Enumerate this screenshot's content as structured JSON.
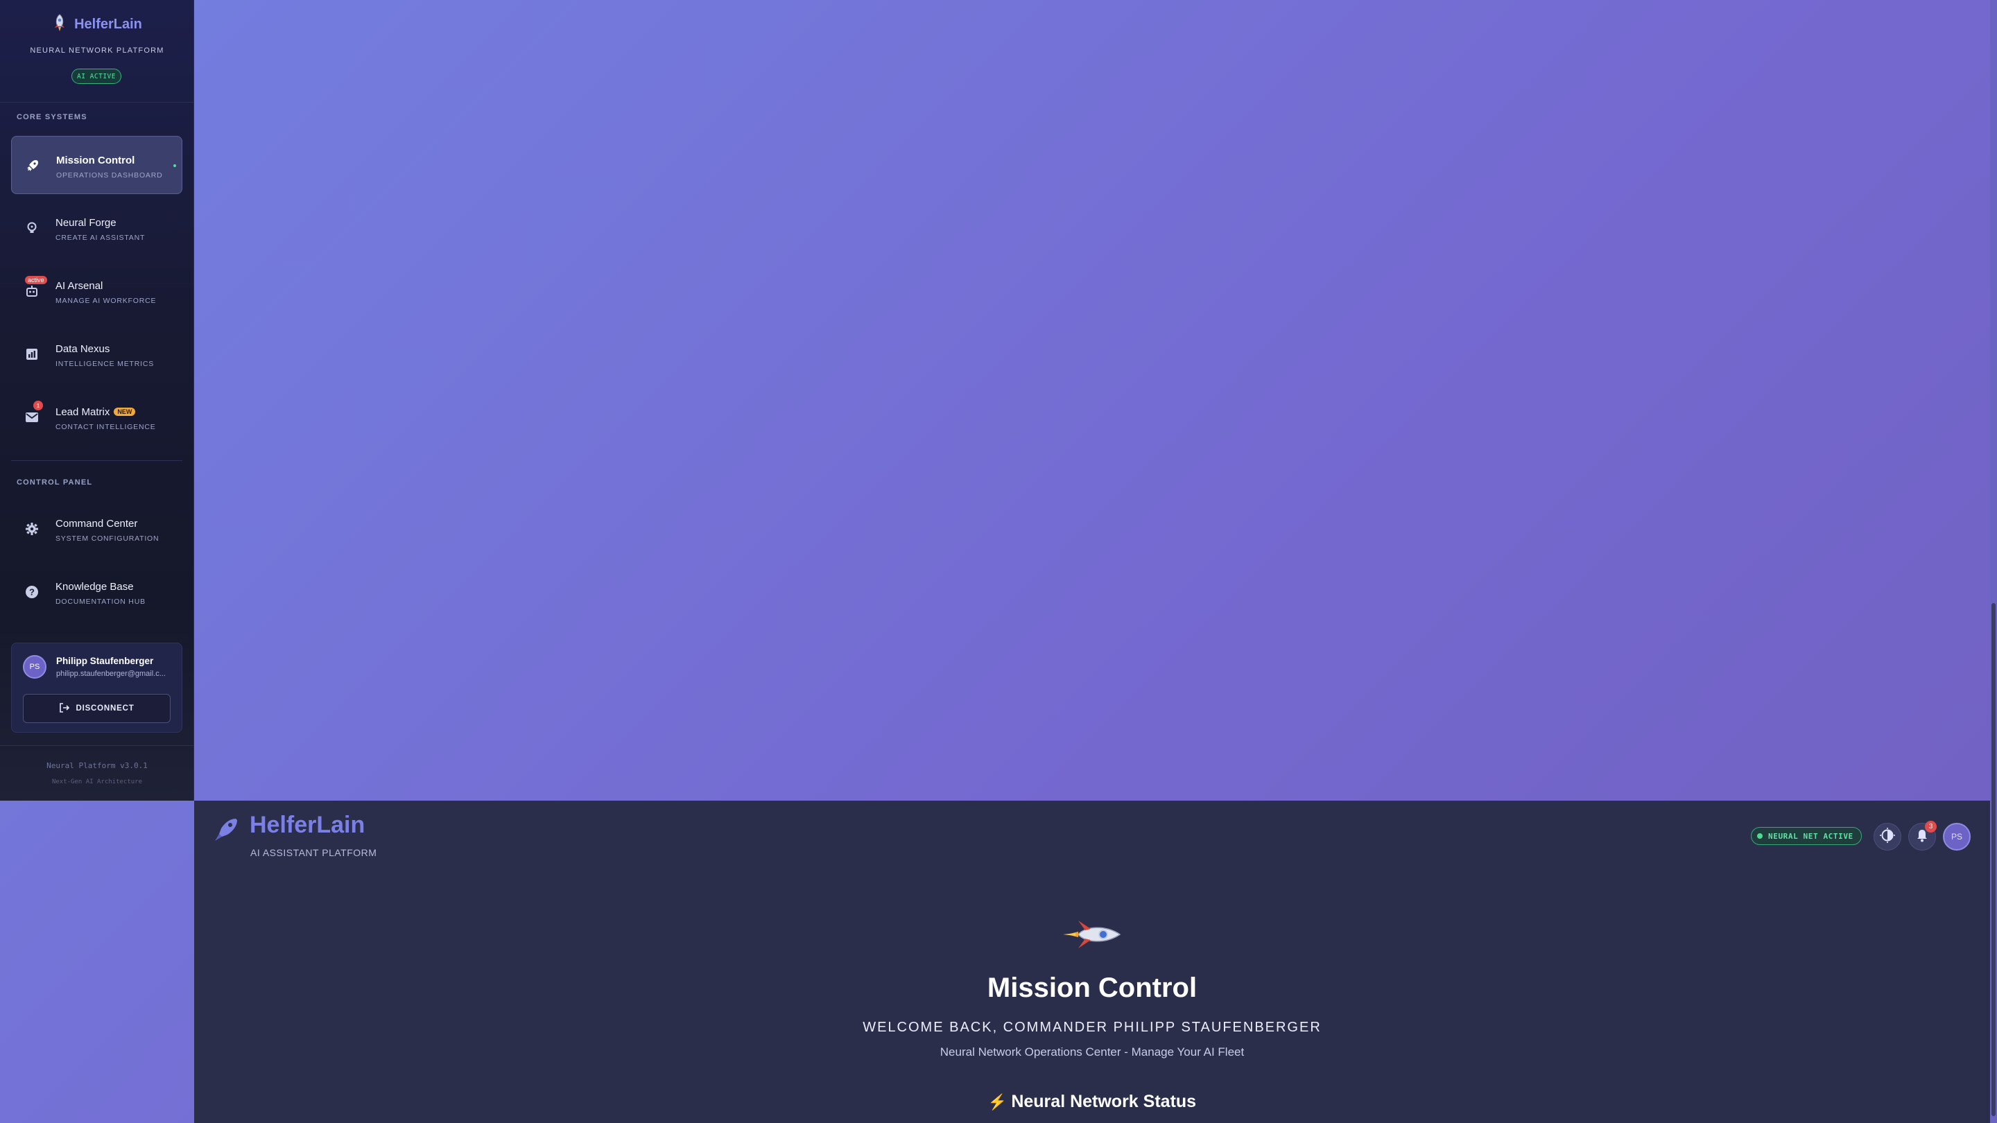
{
  "sidebar": {
    "brand": "HelferLain",
    "tagline": "NEURAL NETWORK PLATFORM",
    "ai_status": "AI ACTIVE",
    "section_core": "CORE SYSTEMS",
    "section_control": "CONTROL PANEL",
    "items": [
      {
        "label": "Mission Control",
        "sub": "OPERATIONS DASHBOARD",
        "icon": "rocket-icon",
        "active": true
      },
      {
        "label": "Neural Forge",
        "sub": "CREATE AI ASSISTANT",
        "icon": "lightbulb-icon"
      },
      {
        "label": "AI Arsenal",
        "sub": "MANAGE AI WORKFORCE",
        "icon": "robot-icon",
        "badge": "active"
      },
      {
        "label": "Data Nexus",
        "sub": "INTELLIGENCE METRICS",
        "icon": "chart-icon"
      },
      {
        "label": "Lead Matrix",
        "sub": "CONTACT INTELLIGENCE",
        "icon": "mail-icon",
        "badge_count": "1",
        "badge_new": "NEW"
      },
      {
        "label": "Command Center",
        "sub": "SYSTEM CONFIGURATION",
        "icon": "gear-icon"
      },
      {
        "label": "Knowledge Base",
        "sub": "DOCUMENTATION HUB",
        "icon": "help-icon"
      }
    ],
    "user": {
      "initials": "PS",
      "name": "Philipp Staufenberger",
      "email": "philipp.staufenberger@gmail.c..."
    },
    "disconnect_label": "DISCONNECT",
    "version": "Neural Platform v3.0.1",
    "version_sub": "Next-Gen AI Architecture"
  },
  "topbar": {
    "brand": "HelferLain",
    "sub": "AI ASSISTANT PLATFORM",
    "status": "NEURAL NET ACTIVE",
    "notifications": "3",
    "avatar_initials": "PS"
  },
  "hero": {
    "title": "Mission Control",
    "welcome": "WELCOME BACK, COMMANDER PHILIPP STAUFENBERGER",
    "description": "Neural Network Operations Center - Manage Your AI Fleet",
    "status_heading": "Neural Network Status"
  },
  "colors": {
    "accent": "#7a80e6",
    "active_green": "#58e0a1",
    "badge_red": "#e24b4b",
    "badge_new": "#f2a93b"
  }
}
